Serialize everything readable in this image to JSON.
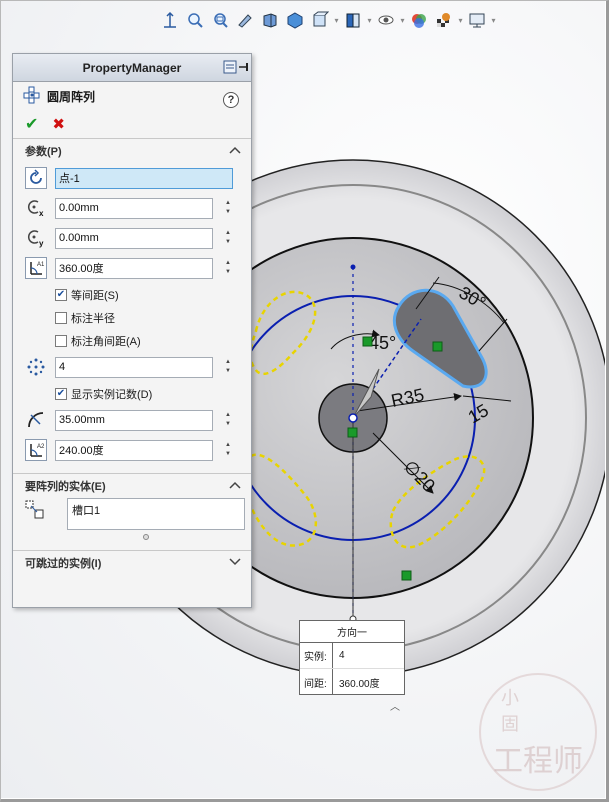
{
  "toolbar": {
    "icons": [
      "zoom-to-fit-icon",
      "zoom-area-icon",
      "previous-view-icon",
      "section-view-icon",
      "view-orientation-icon",
      "display-style-icon",
      "hide-show-items-icon",
      "edit-appearance-icon",
      "apply-scene-icon",
      "view-settings-icon"
    ]
  },
  "pm": {
    "title": "PropertyManager",
    "feature_name": "圆周阵列",
    "help": "?",
    "ok": "✔",
    "cancel": "✖",
    "params": {
      "title": "参数(P)",
      "axis": "点-1",
      "x": "0.00mm",
      "y": "0.00mm",
      "total_angle": "360.00度",
      "equal_spacing": "等间距(S)",
      "equal_spacing_checked": true,
      "dim_radius": "标注半径",
      "dim_radius_checked": false,
      "dim_angle": "标注角间距(A)",
      "dim_angle_checked": false,
      "count": "4",
      "show_count": "显示实例记数(D)",
      "show_count_checked": true,
      "radius": "35.00mm",
      "arc_angle": "240.00度"
    },
    "entities": {
      "title": "要阵列的实体(E)",
      "item": "槽口1"
    },
    "skip": {
      "title": "可跳过的实例(I)"
    }
  },
  "sketch": {
    "dim_30": "30°",
    "dim_45": "45°",
    "dim_r35": "R35",
    "dim_15": "15",
    "dim_d20": "∅20"
  },
  "callout": {
    "title": "方向一",
    "count_label": "实例:",
    "count_value": "4",
    "spacing_label": "间距:",
    "spacing_value": "360.00度"
  },
  "watermark": {
    "top": "小 固",
    "main": "工程师"
  },
  "colors": {
    "sketch_blue": "#0a1fb0",
    "selected_blue": "#5aa9f0",
    "preview_yellow": "#e8d400",
    "accept_green": "#1a9a2a",
    "cancel_red": "#d01010"
  }
}
